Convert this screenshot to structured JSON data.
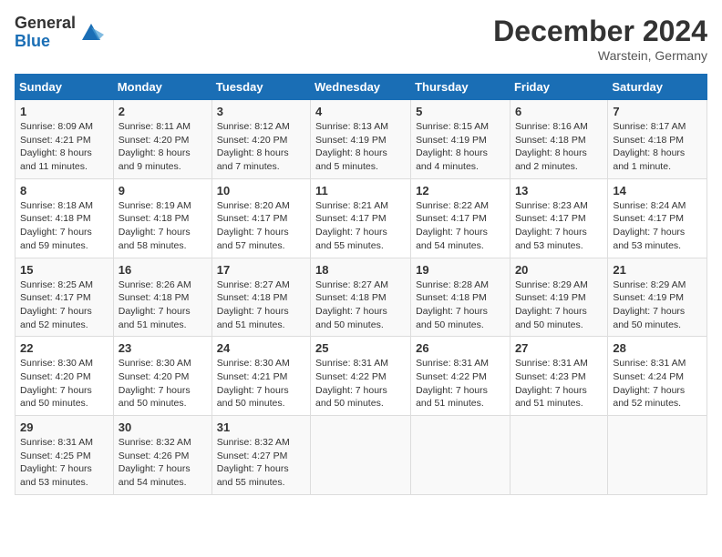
{
  "logo": {
    "general": "General",
    "blue": "Blue"
  },
  "header": {
    "month": "December 2024",
    "location": "Warstein, Germany"
  },
  "weekdays": [
    "Sunday",
    "Monday",
    "Tuesday",
    "Wednesday",
    "Thursday",
    "Friday",
    "Saturday"
  ],
  "weeks": [
    [
      {
        "day": "1",
        "sunrise": "8:09 AM",
        "sunset": "4:21 PM",
        "daylight": "8 hours and 11 minutes."
      },
      {
        "day": "2",
        "sunrise": "8:11 AM",
        "sunset": "4:20 PM",
        "daylight": "8 hours and 9 minutes."
      },
      {
        "day": "3",
        "sunrise": "8:12 AM",
        "sunset": "4:20 PM",
        "daylight": "8 hours and 7 minutes."
      },
      {
        "day": "4",
        "sunrise": "8:13 AM",
        "sunset": "4:19 PM",
        "daylight": "8 hours and 5 minutes."
      },
      {
        "day": "5",
        "sunrise": "8:15 AM",
        "sunset": "4:19 PM",
        "daylight": "8 hours and 4 minutes."
      },
      {
        "day": "6",
        "sunrise": "8:16 AM",
        "sunset": "4:18 PM",
        "daylight": "8 hours and 2 minutes."
      },
      {
        "day": "7",
        "sunrise": "8:17 AM",
        "sunset": "4:18 PM",
        "daylight": "8 hours and 1 minute."
      }
    ],
    [
      {
        "day": "8",
        "sunrise": "8:18 AM",
        "sunset": "4:18 PM",
        "daylight": "7 hours and 59 minutes."
      },
      {
        "day": "9",
        "sunrise": "8:19 AM",
        "sunset": "4:18 PM",
        "daylight": "7 hours and 58 minutes."
      },
      {
        "day": "10",
        "sunrise": "8:20 AM",
        "sunset": "4:17 PM",
        "daylight": "7 hours and 57 minutes."
      },
      {
        "day": "11",
        "sunrise": "8:21 AM",
        "sunset": "4:17 PM",
        "daylight": "7 hours and 55 minutes."
      },
      {
        "day": "12",
        "sunrise": "8:22 AM",
        "sunset": "4:17 PM",
        "daylight": "7 hours and 54 minutes."
      },
      {
        "day": "13",
        "sunrise": "8:23 AM",
        "sunset": "4:17 PM",
        "daylight": "7 hours and 53 minutes."
      },
      {
        "day": "14",
        "sunrise": "8:24 AM",
        "sunset": "4:17 PM",
        "daylight": "7 hours and 53 minutes."
      }
    ],
    [
      {
        "day": "15",
        "sunrise": "8:25 AM",
        "sunset": "4:17 PM",
        "daylight": "7 hours and 52 minutes."
      },
      {
        "day": "16",
        "sunrise": "8:26 AM",
        "sunset": "4:18 PM",
        "daylight": "7 hours and 51 minutes."
      },
      {
        "day": "17",
        "sunrise": "8:27 AM",
        "sunset": "4:18 PM",
        "daylight": "7 hours and 51 minutes."
      },
      {
        "day": "18",
        "sunrise": "8:27 AM",
        "sunset": "4:18 PM",
        "daylight": "7 hours and 50 minutes."
      },
      {
        "day": "19",
        "sunrise": "8:28 AM",
        "sunset": "4:18 PM",
        "daylight": "7 hours and 50 minutes."
      },
      {
        "day": "20",
        "sunrise": "8:29 AM",
        "sunset": "4:19 PM",
        "daylight": "7 hours and 50 minutes."
      },
      {
        "day": "21",
        "sunrise": "8:29 AM",
        "sunset": "4:19 PM",
        "daylight": "7 hours and 50 minutes."
      }
    ],
    [
      {
        "day": "22",
        "sunrise": "8:30 AM",
        "sunset": "4:20 PM",
        "daylight": "7 hours and 50 minutes."
      },
      {
        "day": "23",
        "sunrise": "8:30 AM",
        "sunset": "4:20 PM",
        "daylight": "7 hours and 50 minutes."
      },
      {
        "day": "24",
        "sunrise": "8:30 AM",
        "sunset": "4:21 PM",
        "daylight": "7 hours and 50 minutes."
      },
      {
        "day": "25",
        "sunrise": "8:31 AM",
        "sunset": "4:22 PM",
        "daylight": "7 hours and 50 minutes."
      },
      {
        "day": "26",
        "sunrise": "8:31 AM",
        "sunset": "4:22 PM",
        "daylight": "7 hours and 51 minutes."
      },
      {
        "day": "27",
        "sunrise": "8:31 AM",
        "sunset": "4:23 PM",
        "daylight": "7 hours and 51 minutes."
      },
      {
        "day": "28",
        "sunrise": "8:31 AM",
        "sunset": "4:24 PM",
        "daylight": "7 hours and 52 minutes."
      }
    ],
    [
      {
        "day": "29",
        "sunrise": "8:31 AM",
        "sunset": "4:25 PM",
        "daylight": "7 hours and 53 minutes."
      },
      {
        "day": "30",
        "sunrise": "8:32 AM",
        "sunset": "4:26 PM",
        "daylight": "7 hours and 54 minutes."
      },
      {
        "day": "31",
        "sunrise": "8:32 AM",
        "sunset": "4:27 PM",
        "daylight": "7 hours and 55 minutes."
      },
      null,
      null,
      null,
      null
    ]
  ]
}
